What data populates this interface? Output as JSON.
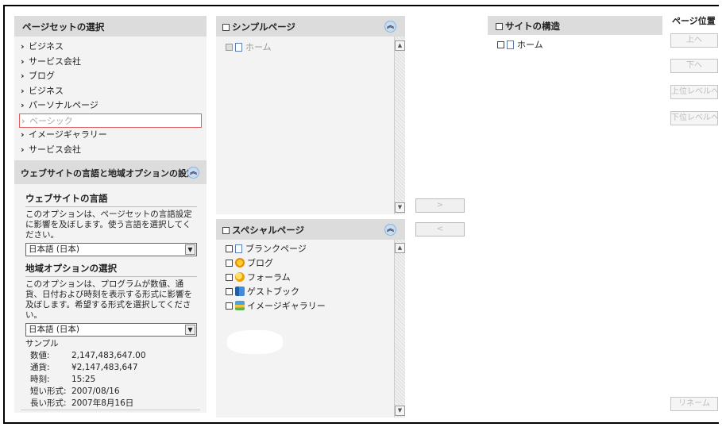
{
  "left": {
    "pageset_header": "ページセットの選択",
    "nav_items": [
      {
        "label": "ビジネス"
      },
      {
        "label": "サービス会社"
      },
      {
        "label": "ブログ"
      },
      {
        "label": "ビジネス"
      },
      {
        "label": "パーソナルページ"
      },
      {
        "label": "ベーシック"
      },
      {
        "label": "イメージギャラリー"
      },
      {
        "label": "サービス会社"
      }
    ],
    "lang_header": "ウェブサイトの言語と地域オプションの設定",
    "website_language": {
      "title": "ウェブサイトの言語",
      "desc": "このオプションは、ページセットの言語設定に影響を及ぼします。使う言語を選択してください。",
      "value": "日本語 (日本)"
    },
    "locale": {
      "title": "地域オプションの選択",
      "desc": "このオプションは、プログラムが数値、通貨、日付および時刻を表示する形式に影響を及ぼします。希望する形式を選択してください。",
      "value": "日本語 (日本)"
    },
    "sample": {
      "label": "サンプル",
      "rows": [
        {
          "k": "数値:",
          "v": "2,147,483,647.00"
        },
        {
          "k": "通貨:",
          "v": "¥2,147,483,647"
        },
        {
          "k": "時刻:",
          "v": "15:25"
        },
        {
          "k": "短い形式:",
          "v": "2007/08/16"
        },
        {
          "k": "長い形式:",
          "v": "2007年8月16日"
        }
      ]
    }
  },
  "simple": {
    "header": "シンプルページ",
    "items": [
      {
        "label": "ホーム"
      }
    ]
  },
  "special": {
    "header": "スペシャルページ",
    "items": [
      {
        "label": "ブランクページ"
      },
      {
        "label": "ブログ"
      },
      {
        "label": "フォーラム"
      },
      {
        "label": "ゲストブック"
      },
      {
        "label": "イメージギャラリー"
      }
    ]
  },
  "move": {
    "add": ">",
    "remove": "<"
  },
  "structure": {
    "header": "サイトの構造",
    "items": [
      {
        "label": "ホーム"
      }
    ]
  },
  "position": {
    "title": "ページ位置",
    "up": "上へ",
    "down": "下へ",
    "level_up": "上位レベルへ",
    "level_down": "下位レベルへ",
    "rename": "リネーム"
  }
}
